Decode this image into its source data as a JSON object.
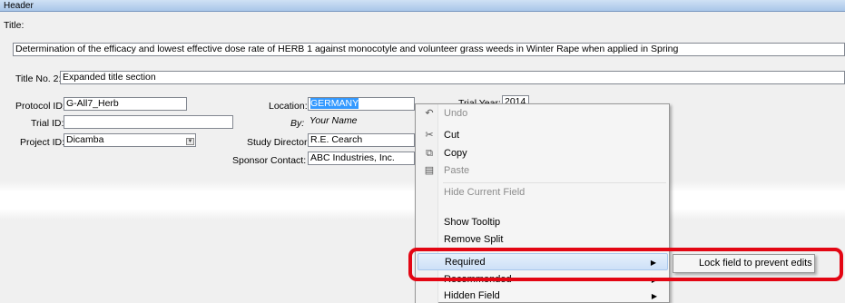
{
  "header": {
    "title": "Header"
  },
  "title_label": "Title:",
  "title_value": "Determination of the efficacy and lowest effective dose rate of HERB 1 against monocotyle and volunteer grass weeds in Winter Rape when applied in Spring",
  "title_no2_label": "Title No. 2:",
  "title_no2_value": "Expanded title section",
  "protocol_id": {
    "label": "Protocol ID:",
    "value": "G-All7_Herb"
  },
  "trial_id": {
    "label": "Trial ID:",
    "value": ""
  },
  "project_id": {
    "label": "Project ID:",
    "value": "Dicamba"
  },
  "location": {
    "label": "Location:",
    "value": "GERMANY"
  },
  "by": {
    "label": "By:",
    "value": "Your Name"
  },
  "study_director": {
    "label": "Study Director:",
    "value": "R.E. Cearch"
  },
  "sponsor_contact": {
    "label": "Sponsor Contact:",
    "value": "ABC Industries, Inc."
  },
  "trial_year": {
    "label": "Trial Year:",
    "value": "2014"
  },
  "context_menu": {
    "items": [
      {
        "label": "Undo",
        "icon": "undo-icon",
        "glyph": "↶",
        "disabled": true
      },
      {
        "label": "Cut",
        "icon": "scissors-icon",
        "glyph": "✂",
        "disabled": false
      },
      {
        "label": "Copy",
        "icon": "copy-icon",
        "glyph": "⧉",
        "disabled": false
      },
      {
        "label": "Paste",
        "icon": "paste-icon",
        "glyph": "▤",
        "disabled": true
      },
      {
        "label": "Hide Current Field",
        "disabled": true
      },
      {
        "label": "Show Tooltip",
        "disabled": false
      },
      {
        "label": "Remove Split",
        "disabled": false
      },
      {
        "label": "Required",
        "disabled": false,
        "submenu": true,
        "highlighted": true
      },
      {
        "label": "Recommended",
        "disabled": false,
        "submenu": true
      },
      {
        "label": "Hidden Field",
        "disabled": false,
        "submenu": true
      }
    ],
    "submenu_item": "Lock field to prevent edits"
  },
  "colors": {
    "highlight_box": "#e30613",
    "selection": "#3399ff",
    "header_bar": "#a9c6e9"
  }
}
